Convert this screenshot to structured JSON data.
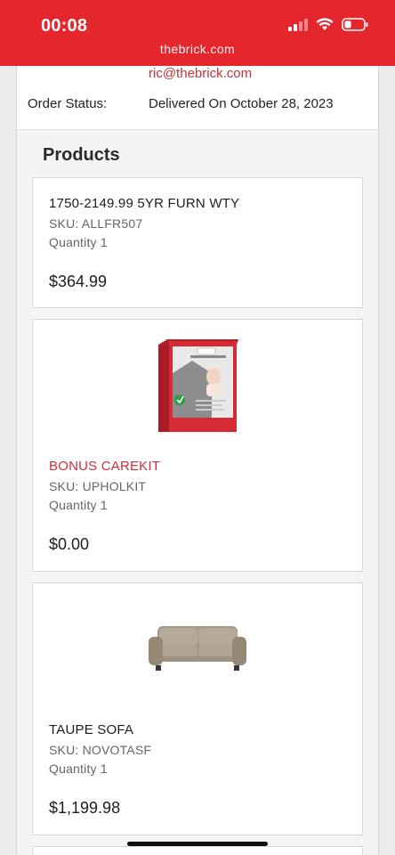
{
  "status_bar": {
    "time": "00:08",
    "url": "thebrick.com",
    "icons": [
      "signal-icon",
      "wifi-icon",
      "battery-icon"
    ]
  },
  "order": {
    "email": "ric@thebrick.com",
    "status_label": "Order Status:",
    "status_value": "Delivered On October 28, 2023"
  },
  "products": {
    "title": "Products",
    "items": [
      {
        "name": "1750-2149.99 5YR FURN WTY",
        "sku": "SKU: ALLFR507",
        "quantity": "Quantity 1",
        "price": "$364.99"
      },
      {
        "name": "BONUS CAREKIT",
        "sku": "SKU: UPHOLKIT",
        "quantity": "Quantity 1",
        "price": "$0.00",
        "image": "carekit-box"
      },
      {
        "name": "TAUPE SOFA",
        "sku": "SKU: NOVOTASF",
        "quantity": "Quantity 1",
        "price": "$1,199.98",
        "image": "taupe-sofa"
      }
    ]
  },
  "colors": {
    "brand_red": "#e6262d",
    "link_red": "#c8313a"
  }
}
